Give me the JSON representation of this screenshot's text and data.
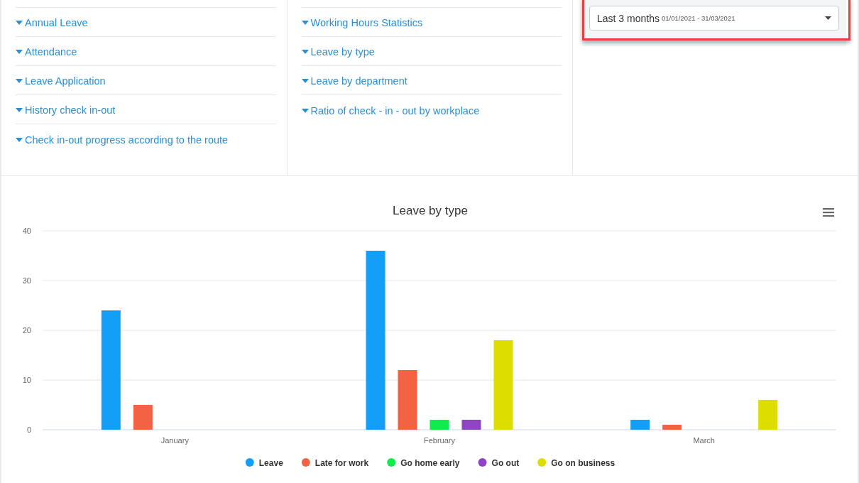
{
  "report_groups": [
    {
      "links": [
        {
          "label": "Annual Leave"
        },
        {
          "label": "Attendance"
        },
        {
          "label": "Leave Application"
        },
        {
          "label": "History check in-out"
        },
        {
          "label": "Check in-out progress according to the route"
        }
      ]
    },
    {
      "links": [
        {
          "label": "Working Hours Statistics"
        },
        {
          "label": "Leave by type"
        },
        {
          "label": "Leave by department"
        },
        {
          "label": "Ratio of check - in - out by workplace"
        }
      ]
    }
  ],
  "date_range": {
    "label": "Last 3 months",
    "range": "01/01/2021 - 31/03/2021",
    "highlighted": true
  },
  "chart": {
    "chart_data": {
      "type": "bar",
      "title": "Leave by type",
      "categories": [
        "January",
        "February",
        "March"
      ],
      "yticks": [
        0,
        10,
        20,
        30,
        40
      ],
      "ylim": [
        0,
        40
      ],
      "grid": true,
      "legend": "bottom",
      "series": [
        {
          "name": "Leave",
          "color": "#139ef8",
          "values": [
            24,
            36,
            2
          ]
        },
        {
          "name": "Late for work",
          "color": "#f36243",
          "values": [
            5,
            12,
            1
          ]
        },
        {
          "name": "Go home early",
          "color": "#10ec4c",
          "values": [
            0,
            2,
            0
          ]
        },
        {
          "name": "Go out",
          "color": "#8f44c4",
          "values": [
            0,
            2,
            0
          ]
        },
        {
          "name": "Go on business",
          "color": "#dddd00",
          "values": [
            0,
            18,
            6
          ]
        }
      ]
    }
  }
}
